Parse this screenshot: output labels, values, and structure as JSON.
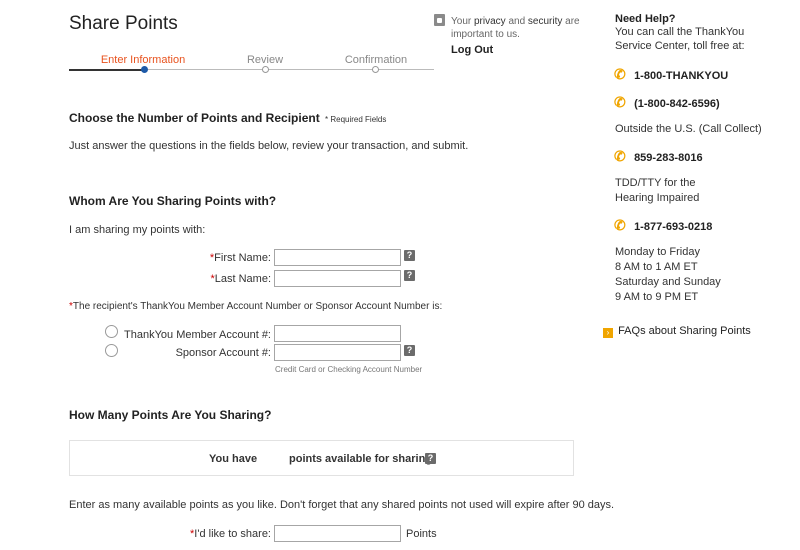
{
  "page": {
    "title": "Share Points"
  },
  "security": {
    "text_pre": "Your ",
    "privacy": "privacy",
    "text_mid": " and ",
    "security": "security",
    "text_post": " are important to us.",
    "logout": "Log Out"
  },
  "steps": {
    "items": [
      "Enter Information",
      "Review",
      "Confirmation"
    ],
    "active_index": 0,
    "active_color": "#e8531f"
  },
  "section1": {
    "heading": "Choose the Number of Points and Recipient",
    "required_note": "* Required Fields",
    "instructions": "Just answer the questions in the fields below, review your transaction, and submit."
  },
  "section2": {
    "heading": "Whom Are You Sharing Points with?",
    "intro": "I am sharing my points with:",
    "first_name_label": "First Name:",
    "last_name_label": "Last Name:",
    "account_prompt": "The recipient's ThankYou Member Account Number or Sponsor Account Number is:",
    "thankyou_label": "ThankYou Member Account #:",
    "sponsor_label": "Sponsor Account #:",
    "sponsor_hint": "Credit Card or Checking Account Number",
    "first_name_value": "",
    "last_name_value": "",
    "thankyou_value": "",
    "sponsor_value": ""
  },
  "section3": {
    "heading": "How Many Points Are You Sharing?",
    "you_have": "You have",
    "available": "points available for sharing.",
    "expire_note": "Enter as many available points as you like. Don't forget that any shared points not used will expire after 90 days.",
    "share_label": "I'd like to share:",
    "share_value": "",
    "points_unit": "Points"
  },
  "sidebar": {
    "heading": "Need Help?",
    "intro": "You can call the ThankYou Service Center, toll free at:",
    "phone1": "1-800-THANKYOU",
    "phone2": "(1-800-842-6596)",
    "outside": "Outside the U.S. (Call Collect)",
    "phone3": "859-283-8016",
    "tdd": "TDD/TTY for the Hearing Impaired",
    "phone4": "1-877-693-0218",
    "hours1": "Monday to Friday",
    "hours2": "8 AM to 1 AM ET",
    "hours3": "Saturday and Sunday",
    "hours4": "9 AM to 9 PM ET",
    "faq": "FAQs about Sharing Points",
    "accent_color": "#f0a500"
  },
  "icons": {
    "required": "*",
    "help": "?",
    "phone": "phone-icon",
    "lock": "lock-icon",
    "faq_arrow": "arrow-right-icon"
  }
}
